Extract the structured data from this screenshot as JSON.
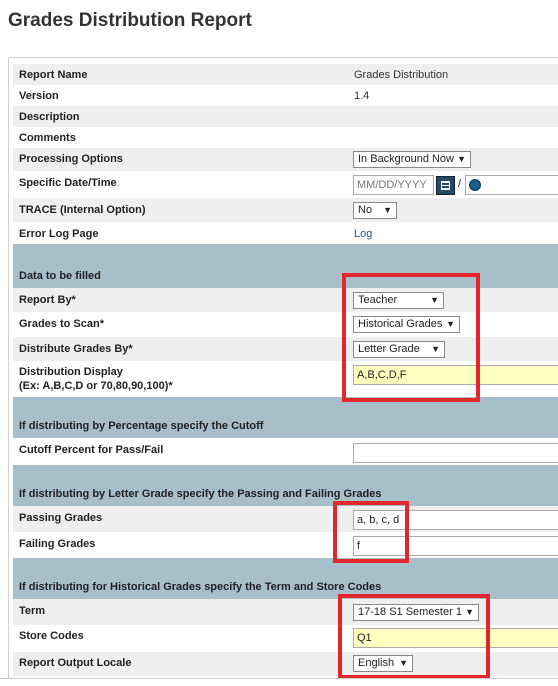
{
  "page": {
    "title": "Grades Distribution Report"
  },
  "rows": {
    "report_name": {
      "label": "Report Name",
      "value": "Grades Distribution"
    },
    "version": {
      "label": "Version",
      "value": "1.4"
    },
    "description": {
      "label": "Description"
    },
    "comments": {
      "label": "Comments"
    },
    "processing": {
      "label": "Processing Options",
      "value": "In Background Now"
    },
    "specific_date": {
      "label": "Specific Date/Time",
      "placeholder": "MM/DD/YYYY",
      "sep": "/"
    },
    "trace": {
      "label": "TRACE (Internal Option)",
      "value": "No"
    },
    "error_log": {
      "label": "Error Log Page",
      "link": "Log"
    }
  },
  "sections": {
    "data_filled": "Data to be filled",
    "percentage": "If distributing by Percentage specify the Cutoff",
    "letter": "If distributing by Letter Grade specify the Passing and Failing Grades",
    "historical": "If distributing for Historical Grades specify the Term and Store Codes"
  },
  "fields": {
    "report_by": {
      "label": "Report By*",
      "value": "Teacher"
    },
    "grades_scan": {
      "label": "Grades to Scan*",
      "value": "Historical Grades"
    },
    "distribute_by": {
      "label": "Distribute Grades By*",
      "value": "Letter Grade"
    },
    "dist_display": {
      "label1": "Distribution Display",
      "label2": "(Ex: A,B,C,D or 70,80,90,100)*",
      "value": "A,B,C,D,F"
    },
    "cutoff": {
      "label": "Cutoff Percent for Pass/Fail",
      "value": ""
    },
    "passing": {
      "label": "Passing Grades",
      "value": "a, b, c, d"
    },
    "failing": {
      "label": "Failing Grades",
      "value": "f"
    },
    "term": {
      "label": "Term",
      "value": "17-18 S1 Semester 1"
    },
    "store_codes": {
      "label": "Store Codes",
      "value": "Q1"
    },
    "locale": {
      "label": "Report Output Locale",
      "value": "English"
    }
  },
  "colors": {
    "section_bg": "#a6bfcb",
    "highlight_box": "#e3262c",
    "input_yellow": "#ffffc0"
  },
  "icons": {
    "calendar": "calendar-icon",
    "clock": "clock-icon",
    "dropdown": "chevron-down-icon"
  }
}
